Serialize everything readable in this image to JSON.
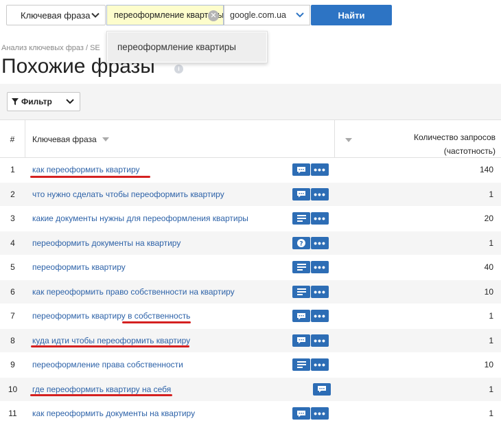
{
  "search": {
    "mode_label": "Ключевая фраза",
    "query": "переоформление квартиры",
    "domain": "google.com.ua",
    "submit_label": "Найти",
    "suggestion": "переоформление квартиры"
  },
  "breadcrumb": "Анализ ключевых фраз / SE",
  "page": {
    "title": "Похожие фразы",
    "filter_label": "Фильтр"
  },
  "table": {
    "headers": {
      "num": "#",
      "phrase": "Ключевая фраза",
      "count_line1": "Количество запросов",
      "count_line2": "(частотность)"
    },
    "rows": [
      {
        "num": "1",
        "phrase": "как переоформить квартиру",
        "count": "140",
        "icon": "comment-icon"
      },
      {
        "num": "2",
        "phrase": "что нужно сделать чтобы переоформить квартиру",
        "count": "1",
        "icon": "comment-icon"
      },
      {
        "num": "3",
        "phrase": "какие документы нужны для переоформления квартиры",
        "count": "20",
        "icon": "list-icon"
      },
      {
        "num": "4",
        "phrase": "переоформить документы на квартиру",
        "count": "1",
        "icon": "question-icon"
      },
      {
        "num": "5",
        "phrase": "переоформить квартиру",
        "count": "40",
        "icon": "list-icon"
      },
      {
        "num": "6",
        "phrase": "как переоформить право собственности на квартиру",
        "count": "10",
        "icon": "list-icon"
      },
      {
        "num": "7",
        "phrase": "переоформить квартиру в собственность",
        "count": "1",
        "icon": "comment-icon"
      },
      {
        "num": "8",
        "phrase": "куда идти чтобы переоформить квартиру",
        "count": "1",
        "icon": "comment-icon"
      },
      {
        "num": "9",
        "phrase": "переоформление права собственности",
        "count": "10",
        "icon": "list-icon"
      },
      {
        "num": "10",
        "phrase": "где переоформить квартиру на себя",
        "count": "1",
        "icon": "comment-icon"
      },
      {
        "num": "11",
        "phrase": "как переоформить документы на квартиру",
        "count": "1",
        "icon": "comment-icon"
      }
    ]
  },
  "colors": {
    "accent": "#2d74c4",
    "link": "#2d62a8",
    "underline": "#d42020",
    "input_bg": "#fdfdcc"
  }
}
